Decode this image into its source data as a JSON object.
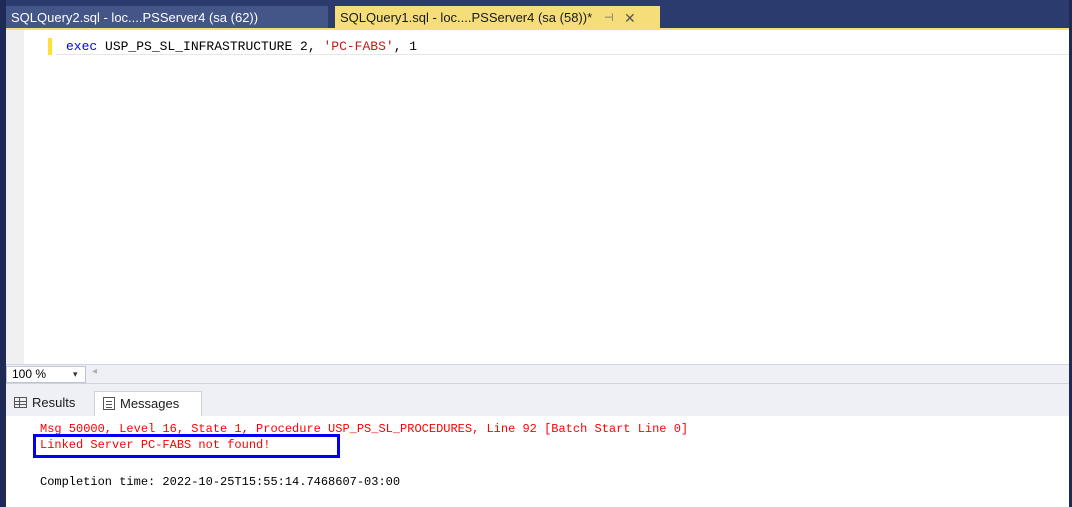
{
  "tabs": [
    {
      "label": "SQLQuery2.sql - loc....PSServer4 (sa (62))",
      "active": false
    },
    {
      "label": "SQLQuery1.sql - loc....PSServer4 (sa (58))*",
      "active": true
    }
  ],
  "tab_icons": {
    "pin": "⊣",
    "close": "✕"
  },
  "editor": {
    "code": {
      "keyword": "exec",
      "procedure": " USP_PS_SL_INFRASTRUCTURE 2, ",
      "string_arg": "'PC-FABS'",
      "rest": ", 1"
    }
  },
  "zoom": {
    "value": "100 %",
    "arrow": "▾",
    "scroll_arrow": "◂"
  },
  "results_tabs": {
    "results": "Results",
    "messages": "Messages"
  },
  "messages": {
    "error": "Msg 50000, Level 16, State 1, Procedure USP_PS_SL_PROCEDURES, Line 92 [Batch Start Line 0]",
    "detail": "Linked Server PC-FABS not found!",
    "completion": "Completion time: 2022-10-25T15:55:14.7468607-03:00"
  },
  "colors": {
    "tabbar": "#2b3b6e",
    "active_tab": "#f5de7a",
    "error_text": "#ff0000",
    "highlight_border": "#0000ee"
  }
}
